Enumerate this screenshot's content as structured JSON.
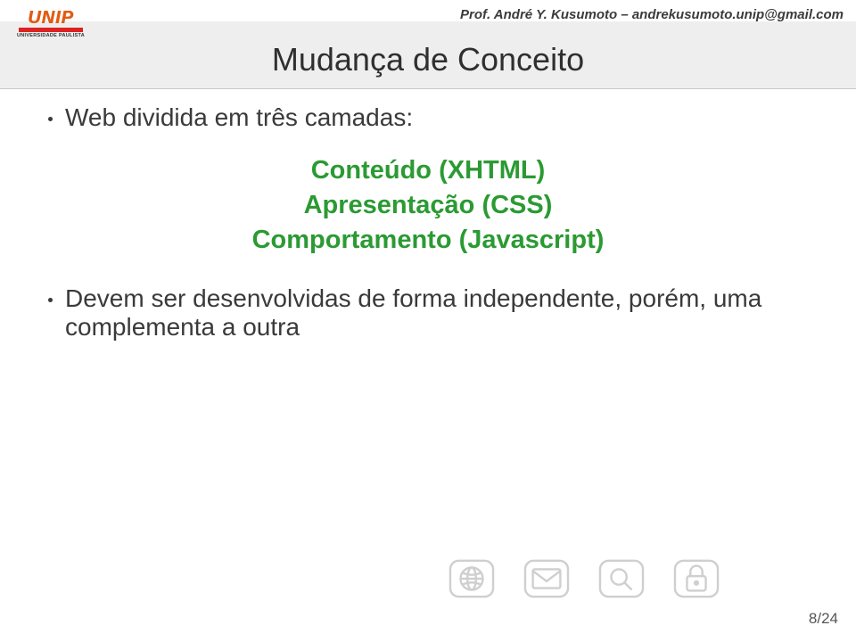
{
  "header": {
    "logo_main": "UNIP",
    "logo_sub": "UNIVERSIDADE PAULISTA",
    "author_line": "Prof. André Y. Kusumoto – andrekusumoto.unip@gmail.com"
  },
  "title": "Mudança de Conceito",
  "bullets": {
    "intro": "Web dividida em três camadas:",
    "outro": "Devem ser desenvolvidas de forma independente, porém, uma complementa a outra"
  },
  "layers": {
    "line1": "Conteúdo (XHTML)",
    "line2": "Apresentação (CSS)",
    "line3": "Comportamento (Javascript)"
  },
  "icons": {
    "globe": "globe-icon",
    "mail": "mail-icon",
    "search": "search-icon",
    "lock": "lock-icon"
  },
  "page_number": "8/24"
}
